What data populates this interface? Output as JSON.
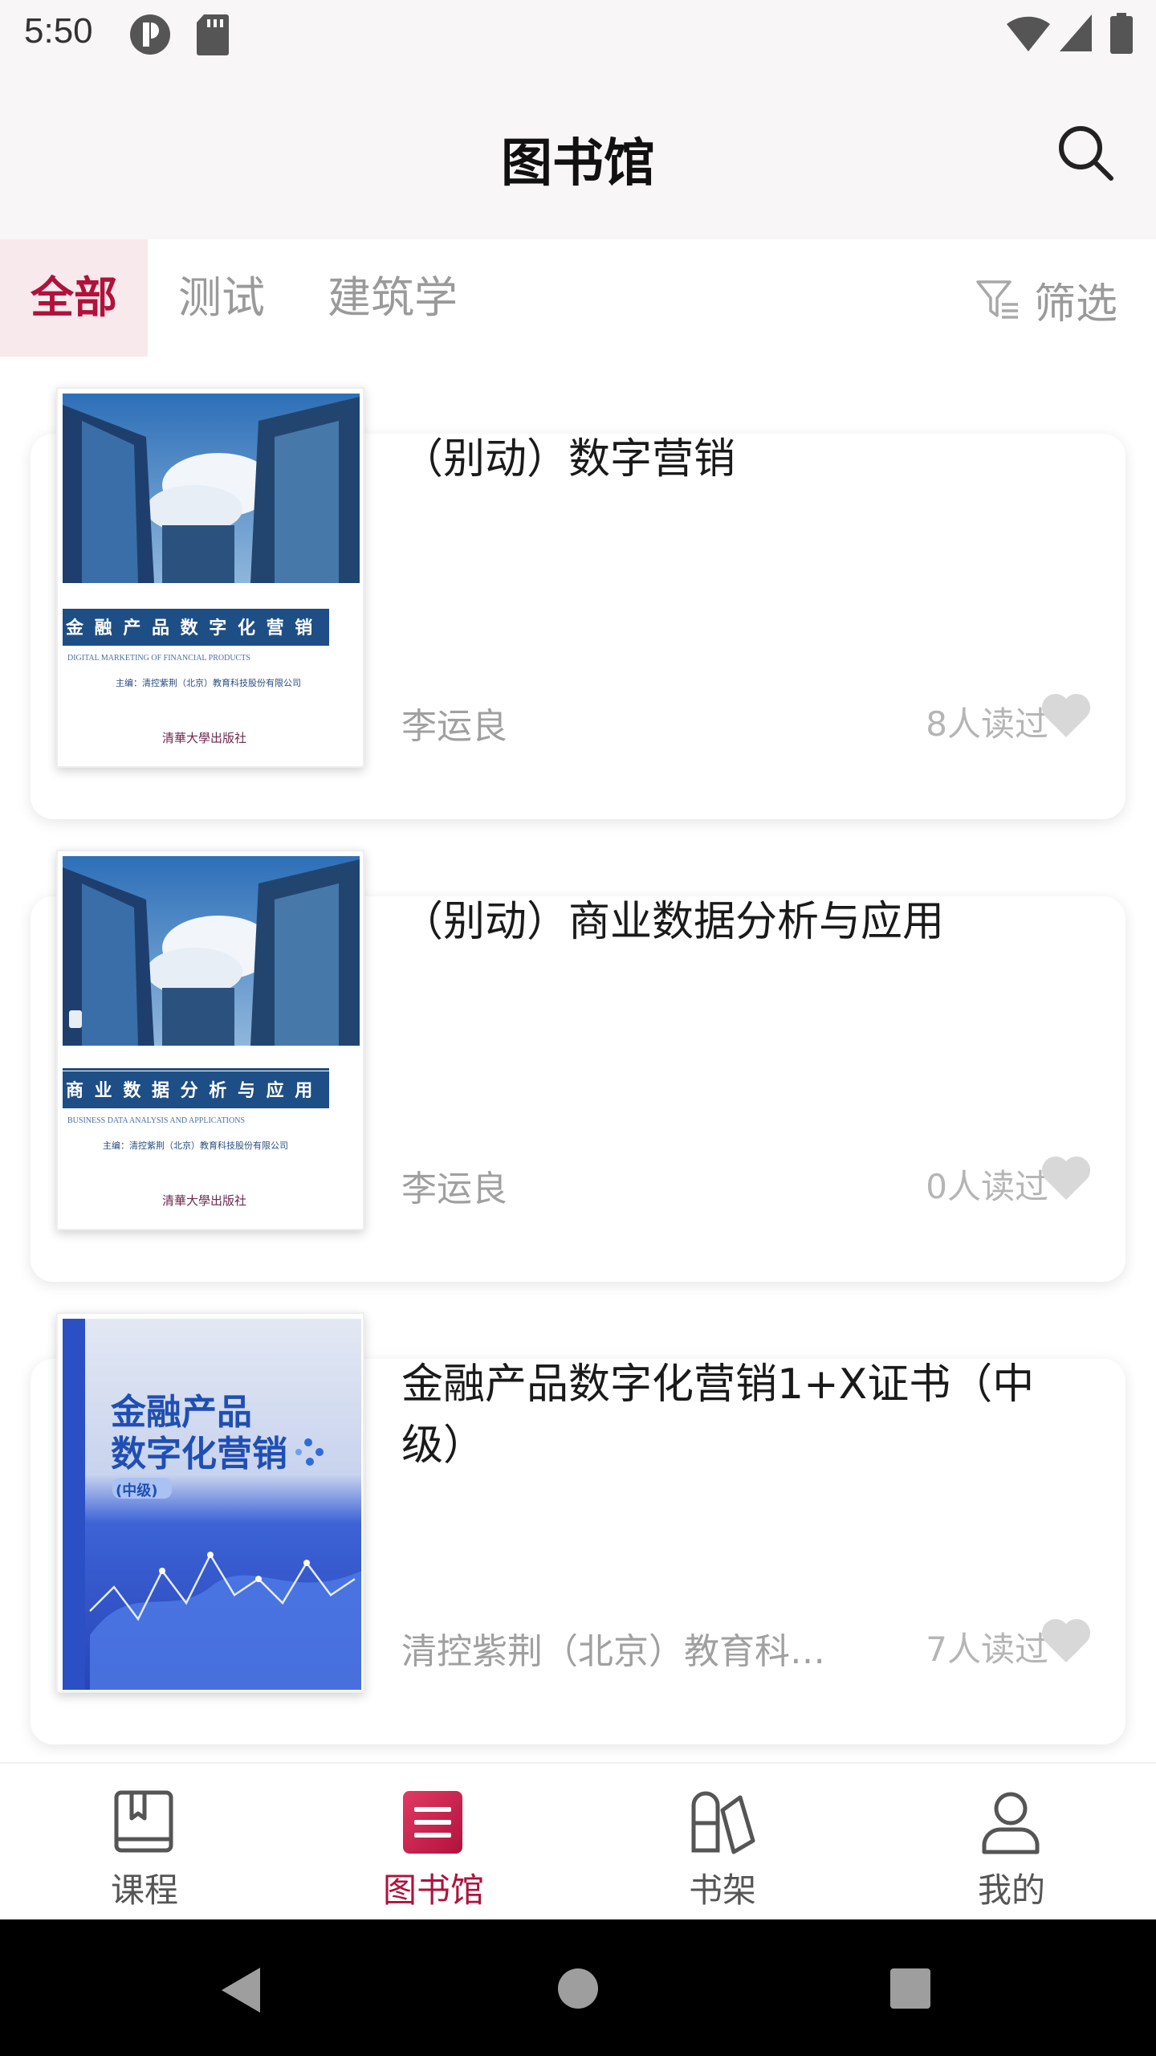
{
  "status_bar": {
    "time": "5:50"
  },
  "app_bar": {
    "title": "图书馆"
  },
  "tabs": [
    {
      "label": "全部",
      "active": true
    },
    {
      "label": "测试",
      "active": false
    },
    {
      "label": "建筑学",
      "active": false
    }
  ],
  "filter": {
    "label": "筛选"
  },
  "books": [
    {
      "title": "（别动）数字营销",
      "author": "李运良",
      "reads": "8人读过",
      "cover": {
        "heading": "金 融 产 品 数 字 化 营 销",
        "subheading": "DIGITAL MARKETING OF FINANCIAL PRODUCTS",
        "editor": "主编：清控紫荆（北京）教育科技股份有限公司",
        "publisher": "清華大學出版社"
      }
    },
    {
      "title": "（别动）商业数据分析与应用",
      "author": "李运良",
      "reads": "0人读过",
      "cover": {
        "heading": "商 业 数 据 分 析 与 应 用",
        "subheading": "BUSINESS DATA ANALYSIS AND APPLICATIONS",
        "editor": "主编：清控紫荆（北京）教育科技股份有限公司",
        "publisher": "清華大學出版社"
      }
    },
    {
      "title": "金融产品数字化营销1+X证书（中级）",
      "author": "清控紫荆（北京）教育科技股份有限公司",
      "reads": "7人读过",
      "cover": {
        "line1": "金融产品",
        "line2": "数字化营销",
        "level": "(中级)"
      }
    }
  ],
  "bottom_nav": [
    {
      "label": "课程",
      "icon": "book-open-icon",
      "active": false
    },
    {
      "label": "图书馆",
      "icon": "library-icon",
      "active": true
    },
    {
      "label": "书架",
      "icon": "bookshelf-icon",
      "active": false
    },
    {
      "label": "我的",
      "icon": "person-icon",
      "active": false
    }
  ],
  "colors": {
    "accent": "#b0123c",
    "tab_active_bg": "#f8e9ec",
    "bar_bg": "#f9f6f7",
    "muted_text": "#a0a0a0"
  }
}
